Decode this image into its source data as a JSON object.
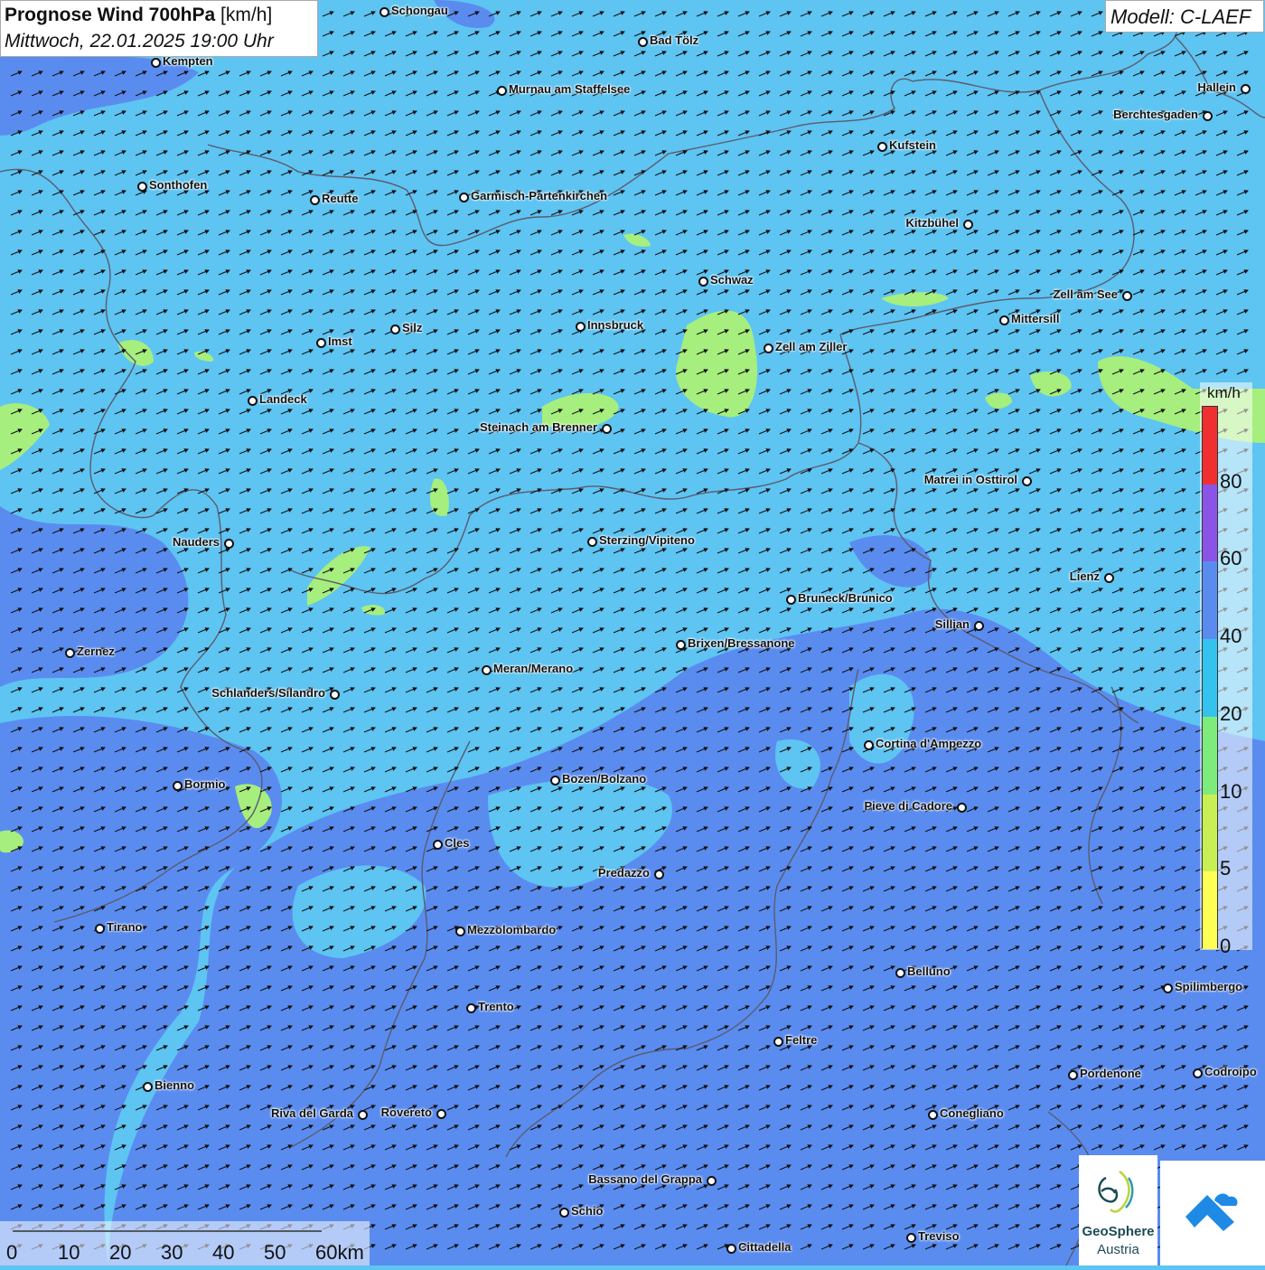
{
  "header": {
    "title": "Prognose Wind 700hPa",
    "unit": "[km/h]",
    "datetime": "Mittwoch, 22.01.2025 19:00 Uhr"
  },
  "model": "Modell: C-LAEF",
  "legend": {
    "unit": "km/h",
    "ticks": [
      "0",
      "5",
      "10",
      "20",
      "40",
      "60",
      "80"
    ],
    "colors": [
      "#ffff55",
      "#c8f055",
      "#7dec7d",
      "#33c3ee",
      "#5a8cf0",
      "#8a55e6",
      "#d8d0f0",
      "#f03030"
    ]
  },
  "scale": {
    "ticks": [
      "0",
      "10",
      "20",
      "30",
      "40",
      "50",
      "60km"
    ]
  },
  "logos": {
    "geosphere_line1": "GeoSphere",
    "geosphere_line2": "Austria"
  },
  "colors": {
    "wind_10_20": "#5ec4f2",
    "wind_20_40": "#5a8cf0",
    "wind_5_10": "#a6ee7e"
  },
  "cities": [
    "Schongau",
    "Bad Tölz",
    "Kempten",
    "Murnau am Staffelsee",
    "Hallein",
    "Berchtesgaden",
    "Kufstein",
    "Sonthofen",
    "Reutte",
    "Garmisch-Partenkirchen",
    "Kitzbühel",
    "Schwaz",
    "Zell am See",
    "Mittersill",
    "Innsbruck",
    "Imst",
    "Silz",
    "Zell am Ziller",
    "Landeck",
    "Steinach am Brenner",
    "Matrei in Osttirol",
    "Nauders",
    "Sterzing/Vipiteno",
    "Lienz",
    "Bruneck/Brunico",
    "Sillian",
    "Zernez",
    "Brixen/Bressanone",
    "Meran/Merano",
    "Schlanders/Silandro",
    "Cortina d'Ampezzo",
    "Bormio",
    "Bozen/Bolzano",
    "Pieve di Cadore",
    "Cles",
    "Predazzo",
    "Tirano",
    "Mezzolombardo",
    "Belluno",
    "Spilimbergo",
    "Trento",
    "Feltre",
    "Pordenone",
    "Codroipo",
    "Bienno",
    "Riva del Garda",
    "Rovereto",
    "Conegliano",
    "Bassano del Grappa",
    "Schio",
    "Treviso",
    "Cittadella"
  ]
}
